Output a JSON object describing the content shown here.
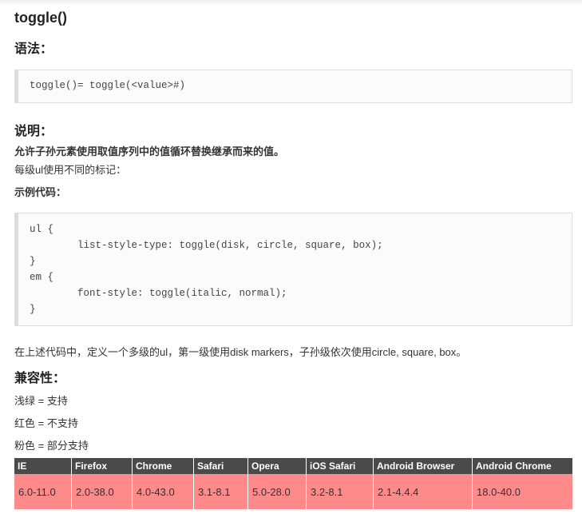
{
  "title": "toggle()",
  "syntax_heading": "语法：",
  "syntax_code": "toggle()= toggle(<value>#)",
  "description_heading": "说明：",
  "description_bold": "允许子孙元素使用取值序列中的值循环替换继承而来的值。",
  "description_line": "每级ul使用不同的标记：",
  "example_label": "示例代码：",
  "example_code": [
    "ul {",
    "        list-style-type: toggle(disk, circle, square, box);",
    "}",
    "em {",
    "        font-style: toggle(italic, normal);",
    "}"
  ],
  "example_note": "在上述代码中，定义一个多级的ul，第一级使用disk markers，子孙级依次使用circle, square, box。",
  "compat_heading": "兼容性：",
  "legend": [
    "浅绿 = 支持",
    "红色 = 不支持",
    "粉色 = 部分支持"
  ],
  "compat_table": {
    "headers": [
      "IE",
      "Firefox",
      "Chrome",
      "Safari",
      "Opera",
      "iOS Safari",
      "Android Browser",
      "Android Chrome"
    ],
    "row": [
      "6.0-11.0",
      "2.0-38.0",
      "4.0-43.0",
      "3.1-8.1",
      "5.0-28.0",
      "3.2-8.1",
      "2.1-4.4.4",
      "18.0-40.0"
    ],
    "row_color": "#ff8a8a",
    "header_color": "#4a4a4a"
  }
}
